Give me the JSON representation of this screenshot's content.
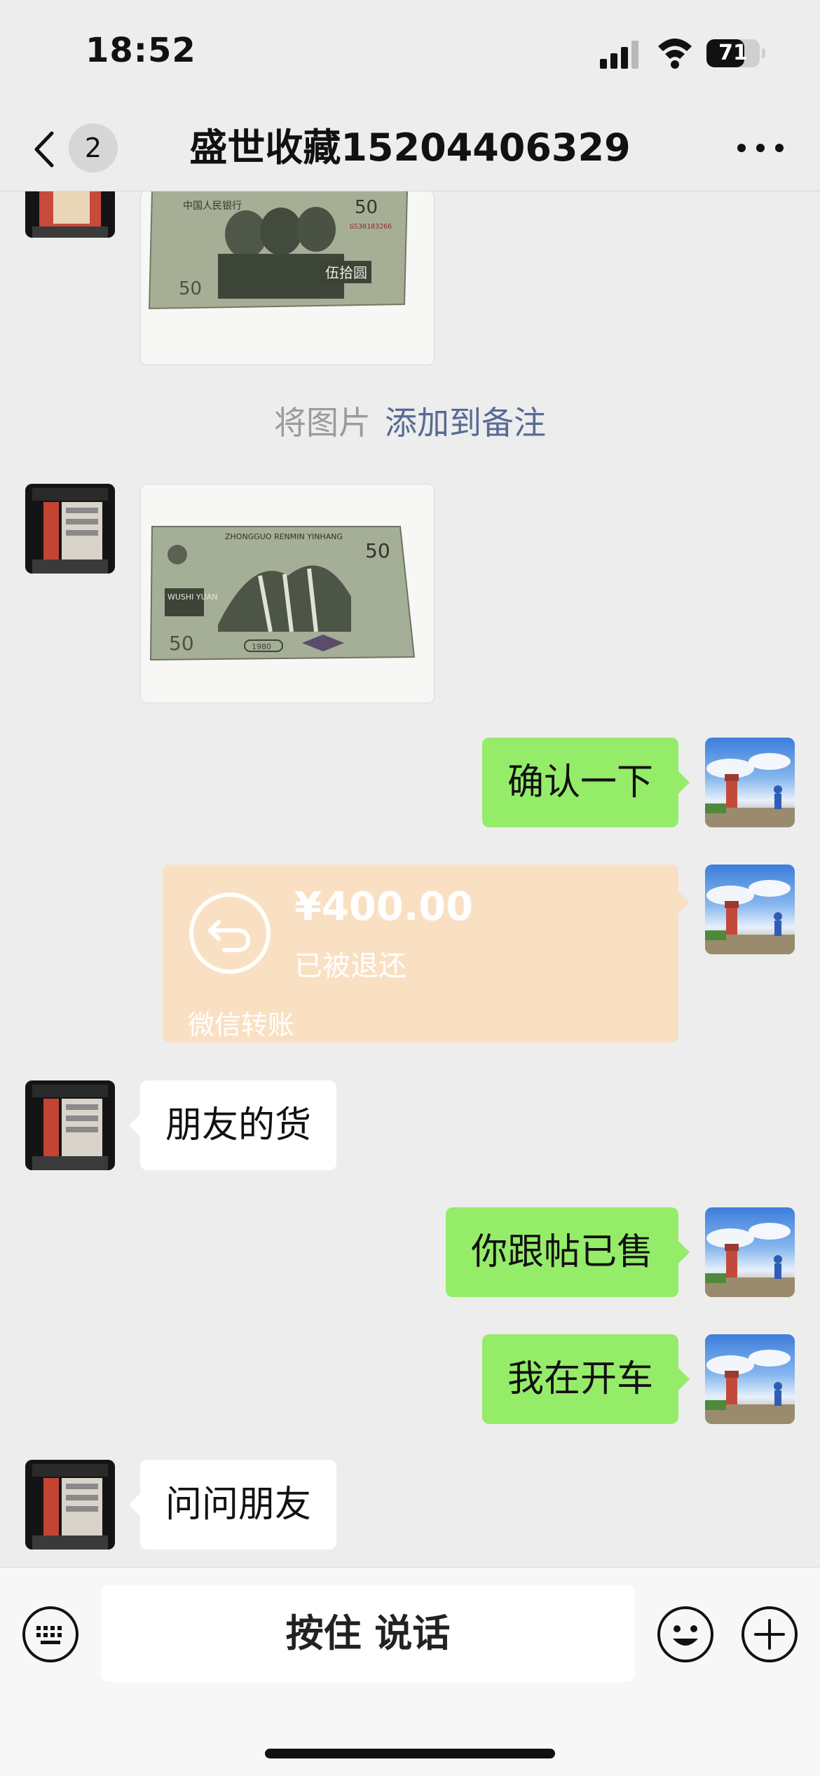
{
  "status_bar": {
    "time": "18:52",
    "battery": "71",
    "battery_level": 0.71
  },
  "nav": {
    "unread_count": "2",
    "title": "盛世收藏15204406329"
  },
  "chat": {
    "system_notice": {
      "prefix": "将图片",
      "link": "添加到备注"
    },
    "messages": {
      "confirm": "确认一下",
      "friends_goods": "朋友的货",
      "sold": "你跟帖已售",
      "driving": "我在开车",
      "ask_friend": "问问朋友"
    },
    "banknote_front": {
      "header": "中国人民银行",
      "denom": "50",
      "chinese_value": "伍拾圆",
      "serial": "GS30103266"
    },
    "banknote_back": {
      "pinyin": "ZHONGGUO RENMIN YINHANG",
      "denom": "50",
      "value_latin": "WUSHI YUAN",
      "year": "1980"
    },
    "transfer": {
      "amount": "¥400.00",
      "status": "已被退还",
      "label": "微信转账"
    }
  },
  "input_bar": {
    "hold_to_talk": "按住 说话"
  },
  "colors": {
    "outgoing_bubble": "#95ec69",
    "incoming_bubble": "#ffffff",
    "transfer_refunded": "#fae0c2",
    "link": "#576b95",
    "background": "#ededed"
  },
  "icons": [
    "back-chevron-icon",
    "more-dots-icon",
    "keyboard-icon",
    "emoji-icon",
    "plus-icon",
    "refund-arrow-icon"
  ]
}
